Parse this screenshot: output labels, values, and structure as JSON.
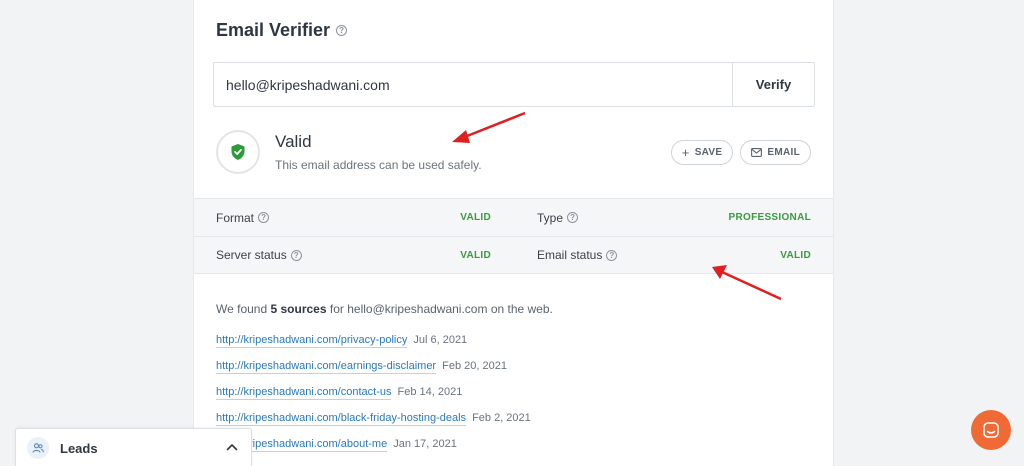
{
  "header": {
    "title": "Email Verifier",
    "help_icon": "?"
  },
  "search": {
    "value": "hello@kripeshadwani.com",
    "button_label": "Verify"
  },
  "result": {
    "status": "Valid",
    "description": "This email address can be used safely.",
    "icon": "shield-check-icon",
    "save_label": "SAVE",
    "email_label": "EMAIL"
  },
  "checks": [
    {
      "label": "Format",
      "value": "VALID",
      "label2": "Type",
      "value2": "PROFESSIONAL"
    },
    {
      "label": "Server status",
      "value": "VALID",
      "label2": "Email status",
      "value2": "VALID"
    }
  ],
  "sources": {
    "prefix": "We found",
    "count": "5 sources",
    "suffix": "for hello@kripeshadwani.com on the web.",
    "items": [
      {
        "url": "http://kripeshadwani.com/privacy-policy",
        "date": "Jul 6, 2021"
      },
      {
        "url": "http://kripeshadwani.com/earnings-disclaimer",
        "date": "Feb 20, 2021"
      },
      {
        "url": "http://kripeshadwani.com/contact-us",
        "date": "Feb 14, 2021"
      },
      {
        "url": "http://kripeshadwani.com/black-friday-hosting-deals",
        "date": "Feb 2, 2021"
      },
      {
        "url": "http://kripeshadwani.com/about-me",
        "date": "Jan 17, 2021"
      }
    ]
  },
  "leads": {
    "label": "Leads"
  },
  "colors": {
    "valid": "#3a9a3f",
    "link": "#2a7ab8",
    "chat": "#f06a36",
    "arrow": "#e02020"
  }
}
